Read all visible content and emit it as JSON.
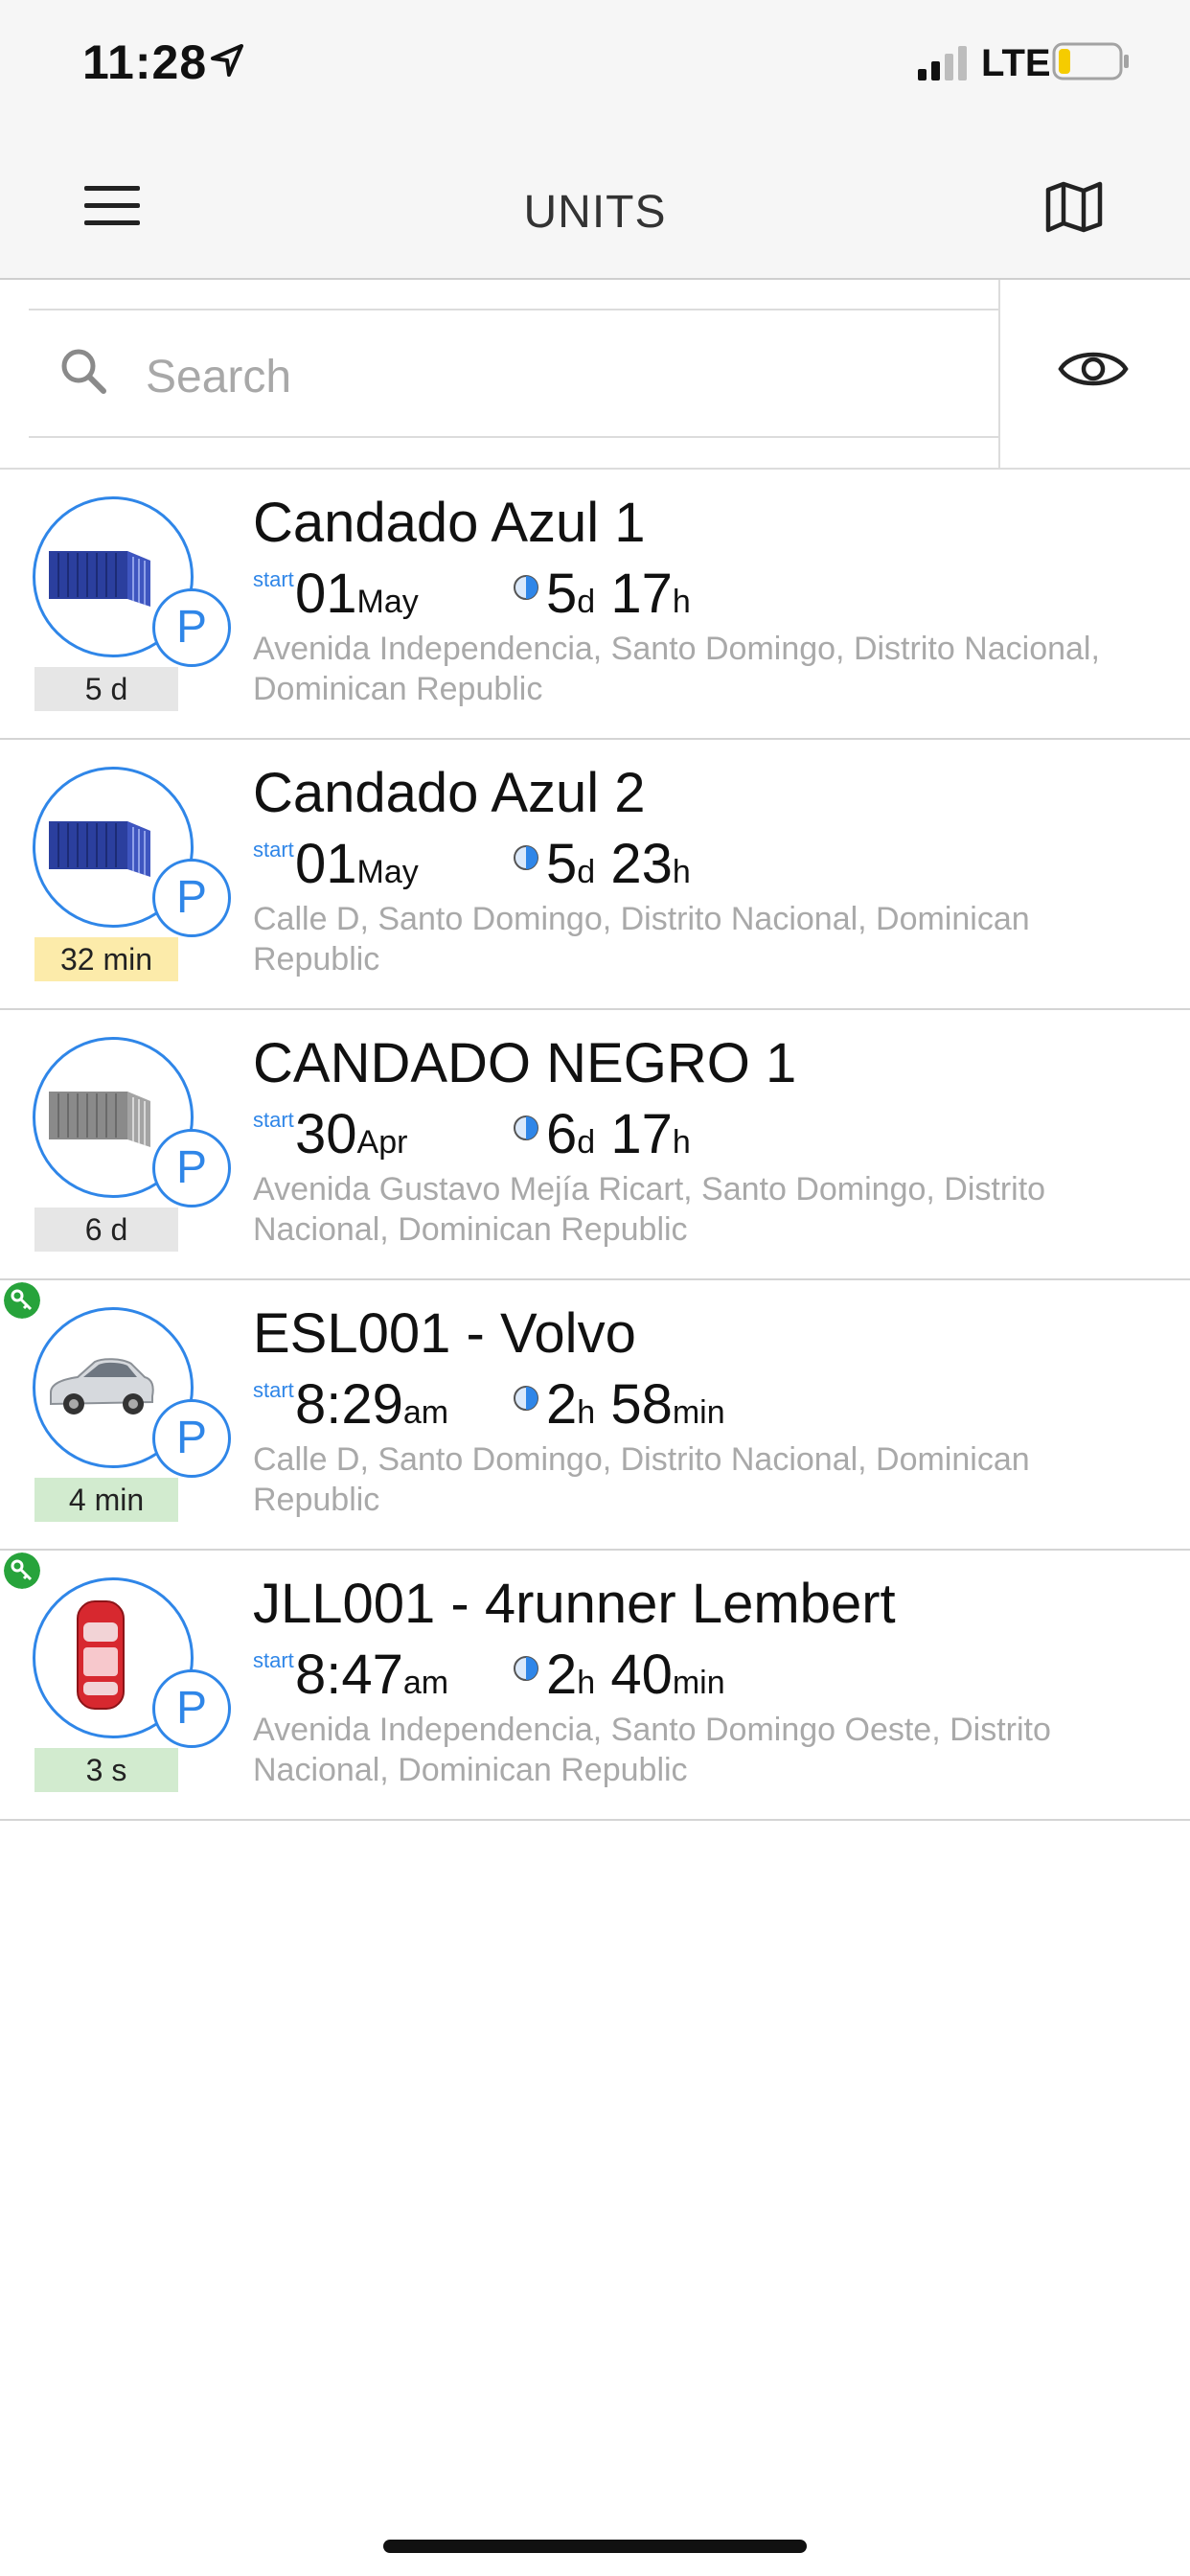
{
  "status_bar": {
    "time": "11:28",
    "network": "LTE",
    "battery_level": 0.2,
    "signal_bars": 2
  },
  "header": {
    "title": "UNITS",
    "menu_icon": "hamburger-menu-icon",
    "map_icon": "map-icon"
  },
  "search": {
    "placeholder": "Search",
    "value": "",
    "visibility_icon": "eye-icon"
  },
  "colors": {
    "accent": "#2f86e8",
    "key_green": "#27a33b",
    "address_grey": "#a9a9a9",
    "badge_grey": "#e6e6e6",
    "badge_yellow": "#fcebaa",
    "badge_green": "#d2ebcf"
  },
  "units": [
    {
      "name": "Candado Azul 1",
      "image": "blue-container",
      "status_icon": "parking-icon",
      "has_key": false,
      "age": "5 d",
      "age_color": "grey",
      "start_label": "start",
      "start_value": "01",
      "start_unit": "May",
      "duration": [
        {
          "v": "5",
          "u": "d"
        },
        {
          "v": "17",
          "u": "h"
        }
      ],
      "address": "Avenida Independencia, Santo Domingo, Distrito Nacional, Dominican Republic"
    },
    {
      "name": "Candado Azul 2",
      "image": "blue-container",
      "status_icon": "parking-icon",
      "has_key": false,
      "age": "32 min",
      "age_color": "yellow",
      "start_label": "start",
      "start_value": "01",
      "start_unit": "May",
      "duration": [
        {
          "v": "5",
          "u": "d"
        },
        {
          "v": "23",
          "u": "h"
        }
      ],
      "address": "Calle D, Santo Domingo, Distrito Nacional, Dominican Republic"
    },
    {
      "name": "CANDADO NEGRO 1",
      "image": "grey-container",
      "status_icon": "parking-icon",
      "has_key": false,
      "age": "6 d",
      "age_color": "grey",
      "start_label": "start",
      "start_value": "30",
      "start_unit": "Apr",
      "duration": [
        {
          "v": "6",
          "u": "d"
        },
        {
          "v": "17",
          "u": "h"
        }
      ],
      "address": "Avenida Gustavo Mejía Ricart, Santo Domingo, Distrito Nacional, Dominican Republic"
    },
    {
      "name": "ESL001 - Volvo",
      "image": "silver-car",
      "status_icon": "parking-icon",
      "has_key": true,
      "age": "4 min",
      "age_color": "green",
      "start_label": "start",
      "start_value": "8:29",
      "start_unit": "am",
      "duration": [
        {
          "v": "2",
          "u": "h"
        },
        {
          "v": "58",
          "u": "min"
        }
      ],
      "address": "Calle D, Santo Domingo, Distrito Nacional, Dominican Republic"
    },
    {
      "name": "JLL001 - 4runner Lembert",
      "image": "red-car",
      "status_icon": "parking-icon",
      "has_key": true,
      "age": "3 s",
      "age_color": "green",
      "start_label": "start",
      "start_value": "8:47",
      "start_unit": "am",
      "duration": [
        {
          "v": "2",
          "u": "h"
        },
        {
          "v": "40",
          "u": "min"
        }
      ],
      "address": "Avenida Independencia, Santo Domingo Oeste, Distrito Nacional, Dominican Republic"
    }
  ]
}
